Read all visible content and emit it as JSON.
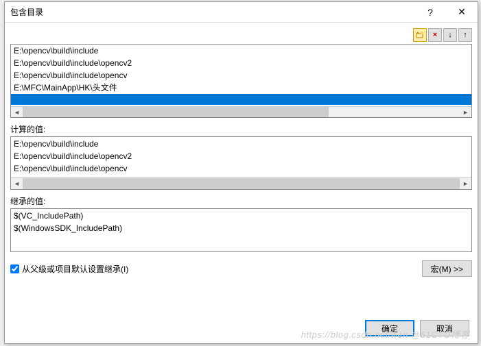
{
  "titlebar": {
    "title": "包含目录"
  },
  "toolbar": {
    "new_folder": "new-folder",
    "delete": "×",
    "down": "↓",
    "up": "↑"
  },
  "editable_paths": [
    "E:\\opencv\\build\\include",
    "E:\\opencv\\build\\include\\opencv2",
    "E:\\opencv\\build\\include\\opencv",
    "E:\\MFC\\MainApp\\HK\\头文件"
  ],
  "labels": {
    "computed": "计算的值:",
    "inherited": "继承的值:",
    "inherit_checkbox": "从父级或项目默认设置继承(I)",
    "macros_btn": "宏(M) >>",
    "ok": "确定",
    "cancel": "取消"
  },
  "computed_paths": [
    "E:\\opencv\\build\\include",
    "E:\\opencv\\build\\include\\opencv2",
    "E:\\opencv\\build\\include\\opencv"
  ],
  "inherited_paths": [
    "$(VC_IncludePath)",
    "$(WindowsSDK_IncludePath)"
  ],
  "inherit_checked": true,
  "watermark": "https://blog.csdn.net/wen @51CTO博客"
}
